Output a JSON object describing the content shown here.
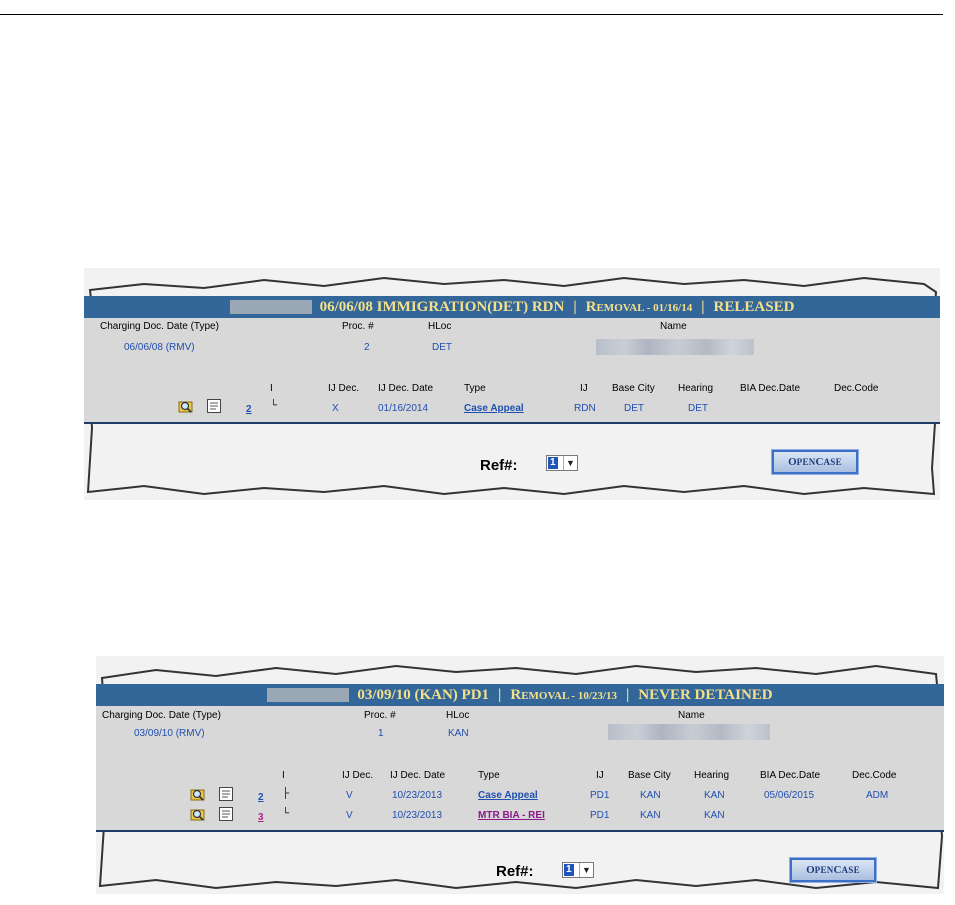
{
  "panels": [
    {
      "header": {
        "date_type": "06/06/08 IMMIGRATION(DET) RDN",
        "sep1": "|",
        "removal_R": "R",
        "removal_rest": "EMOVAL - 01/16/14",
        "sep2": "|",
        "status": "RELEASED"
      },
      "labels": {
        "charging": "Charging Doc. Date (Type)",
        "proc": "Proc. #",
        "hloc": "HLoc",
        "name": "Name"
      },
      "values": {
        "charging": "06/06/08 (RMV)",
        "proc": "2",
        "hloc": "DET"
      },
      "columns": {
        "indent": "I",
        "ij_dec": "IJ Dec.",
        "ij_dec_date": "IJ Dec. Date",
        "type": "Type",
        "ij": "IJ",
        "base_city": "Base City",
        "hearing": "Hearing",
        "bia_dec_date": "BIA Dec.Date",
        "dec_code": "Dec.Code"
      },
      "rows": [
        {
          "num": "2",
          "tree": "└",
          "ij_dec": "X",
          "ij_dec_date": "01/16/2014",
          "type": "Case Appeal",
          "ij": "RDN",
          "base_city": "DET",
          "hearing": "DET",
          "bia_dec_date": "",
          "dec_code": ""
        }
      ],
      "ref_label": "Ref#:",
      "ref_value": "1",
      "open_button": {
        "first": "O",
        "rest1": "PEN ",
        "second": "C",
        "rest2": "ASE"
      }
    },
    {
      "header": {
        "date_type": "03/09/10 (KAN) PD1",
        "sep1": "|",
        "removal_R": "R",
        "removal_rest": "EMOVAL - 10/23/13",
        "sep2": "|",
        "status": "NEVER DETAINED"
      },
      "labels": {
        "charging": "Charging Doc. Date (Type)",
        "proc": "Proc. #",
        "hloc": "HLoc",
        "name": "Name"
      },
      "values": {
        "charging": "03/09/10 (RMV)",
        "proc": "1",
        "hloc": "KAN"
      },
      "columns": {
        "indent": "I",
        "ij_dec": "IJ Dec.",
        "ij_dec_date": "IJ Dec. Date",
        "type": "Type",
        "ij": "IJ",
        "base_city": "Base City",
        "hearing": "Hearing",
        "bia_dec_date": "BIA Dec.Date",
        "dec_code": "Dec.Code"
      },
      "rows": [
        {
          "num": "2",
          "tree": "├",
          "ij_dec": "V",
          "ij_dec_date": "10/23/2013",
          "type": "Case Appeal",
          "ij": "PD1",
          "base_city": "KAN",
          "hearing": "KAN",
          "bia_dec_date": "05/06/2015",
          "dec_code": "ADM"
        },
        {
          "num": "3",
          "tree": "└",
          "ij_dec": "V",
          "ij_dec_date": "10/23/2013",
          "type": "MTR BIA - REI",
          "ij": "PD1",
          "base_city": "KAN",
          "hearing": "KAN",
          "bia_dec_date": "",
          "dec_code": ""
        }
      ],
      "ref_label": "Ref#:",
      "ref_value": "1",
      "open_button": {
        "first": "O",
        "rest1": "PEN ",
        "second": "C",
        "rest2": "ASE"
      }
    }
  ],
  "colors": {
    "header_bg": "#336699",
    "header_text": "#f4e08a",
    "grey_band": "#d8d8d8",
    "link": "#1f4fb0",
    "visited": "#8a1a8a"
  },
  "icons": {
    "view": "magnifier-folder-icon",
    "notes": "document-notes-icon"
  }
}
